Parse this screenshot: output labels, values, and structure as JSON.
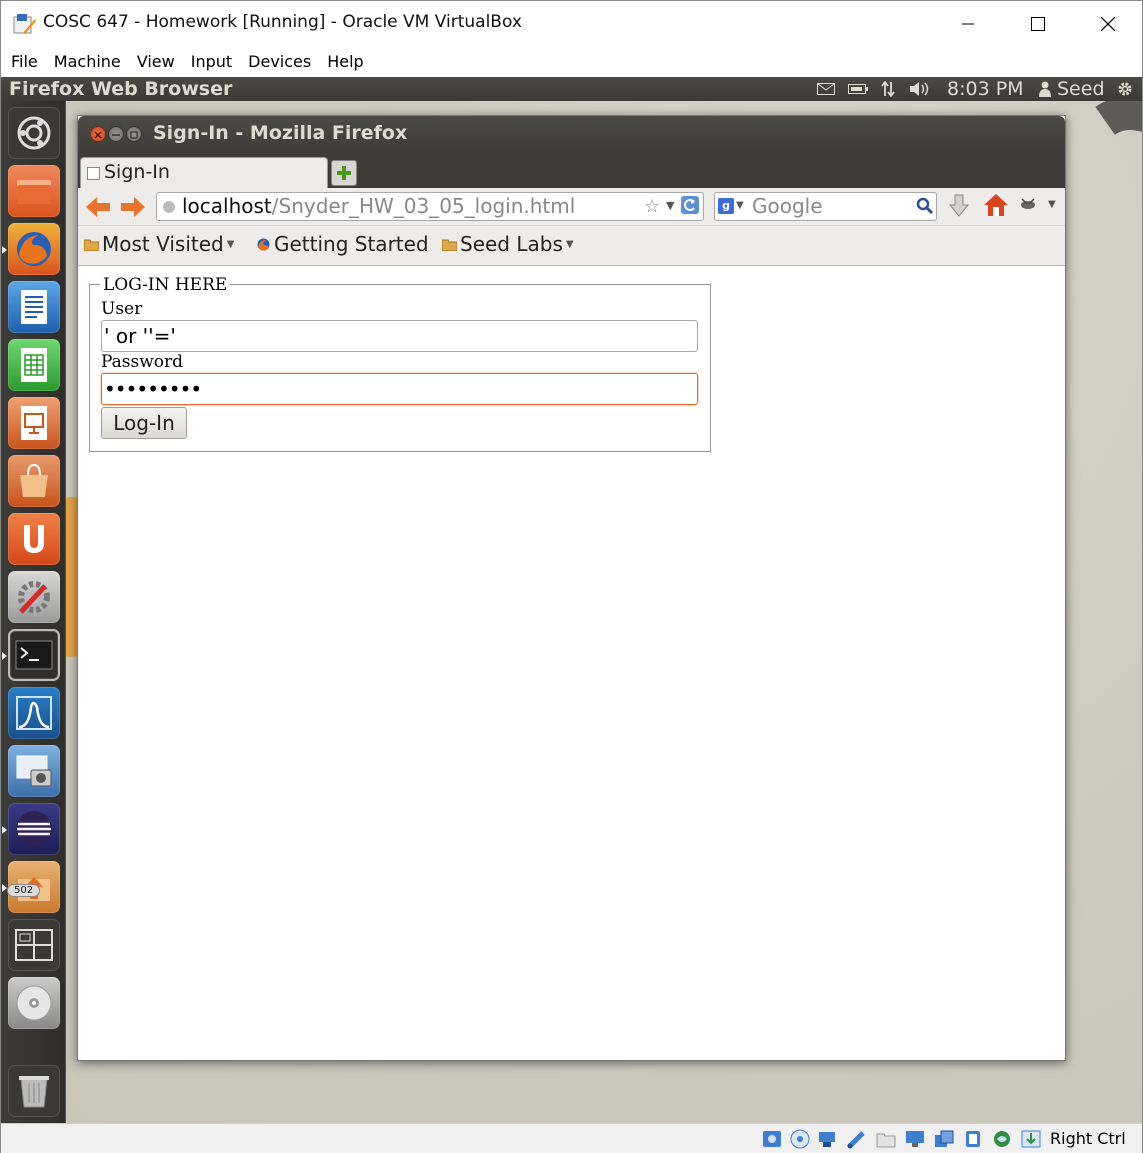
{
  "host_window": {
    "title": "COSC 647 - Homework [Running] - Oracle VM VirtualBox",
    "controls": {
      "minimize": "minimize-icon",
      "maximize": "maximize-icon",
      "close": "close-icon"
    },
    "menu": [
      "File",
      "Machine",
      "View",
      "Input",
      "Devices",
      "Help"
    ]
  },
  "ubuntu_topbar": {
    "title": "Firefox Web Browser",
    "clock": "8:03 PM",
    "user": "Seed",
    "tray_icons": [
      "mail-icon",
      "battery-icon",
      "network-icon",
      "volume-icon",
      "user-icon",
      "gear-icon"
    ]
  },
  "launcher": {
    "items": [
      "dash-home-icon",
      "files-icon",
      "firefox-icon",
      "writer-icon",
      "calc-icon",
      "impress-icon",
      "software-center-icon",
      "ubuntu-one-icon",
      "system-settings-icon",
      "terminal-icon",
      "wireshark-icon",
      "screenshot-icon",
      "eclipse-icon",
      "update-manager-icon",
      "workspace-switcher-icon",
      "cd-drive-icon",
      "trash-icon"
    ],
    "badge": "502"
  },
  "firefox": {
    "window_title": "Sign-In - Mozilla Firefox",
    "tab_label": "Sign-In",
    "url_host": "localhost",
    "url_path": "/Snyder_HW_03_05_login.html",
    "search_placeholder": "Google",
    "search_engine_letter": "g",
    "bookmarks": [
      {
        "label": "Most Visited",
        "dropdown": true
      },
      {
        "label": "Getting Started",
        "dropdown": false
      },
      {
        "label": "Seed Labs",
        "dropdown": true
      }
    ]
  },
  "page": {
    "legend": "LOG-IN HERE",
    "user_label": "User",
    "user_value": "' or ''='",
    "password_label": "Password",
    "password_value": "•••••••••",
    "login_button": "Log-In"
  },
  "vbox_status": {
    "icons": [
      "hdd-icon",
      "optical-icon",
      "network-adapter-icon",
      "usb-icon",
      "shared-folder-icon",
      "display-icon",
      "capture-icon",
      "cpu-icon",
      "vt-icon",
      "mouse-integration-icon"
    ],
    "host_key": "Right Ctrl"
  },
  "colors": {
    "ubuntu_panel": "#3b3a36",
    "focus_orange": "#e26a2c",
    "launcher_bg": "#2f2e2b"
  }
}
